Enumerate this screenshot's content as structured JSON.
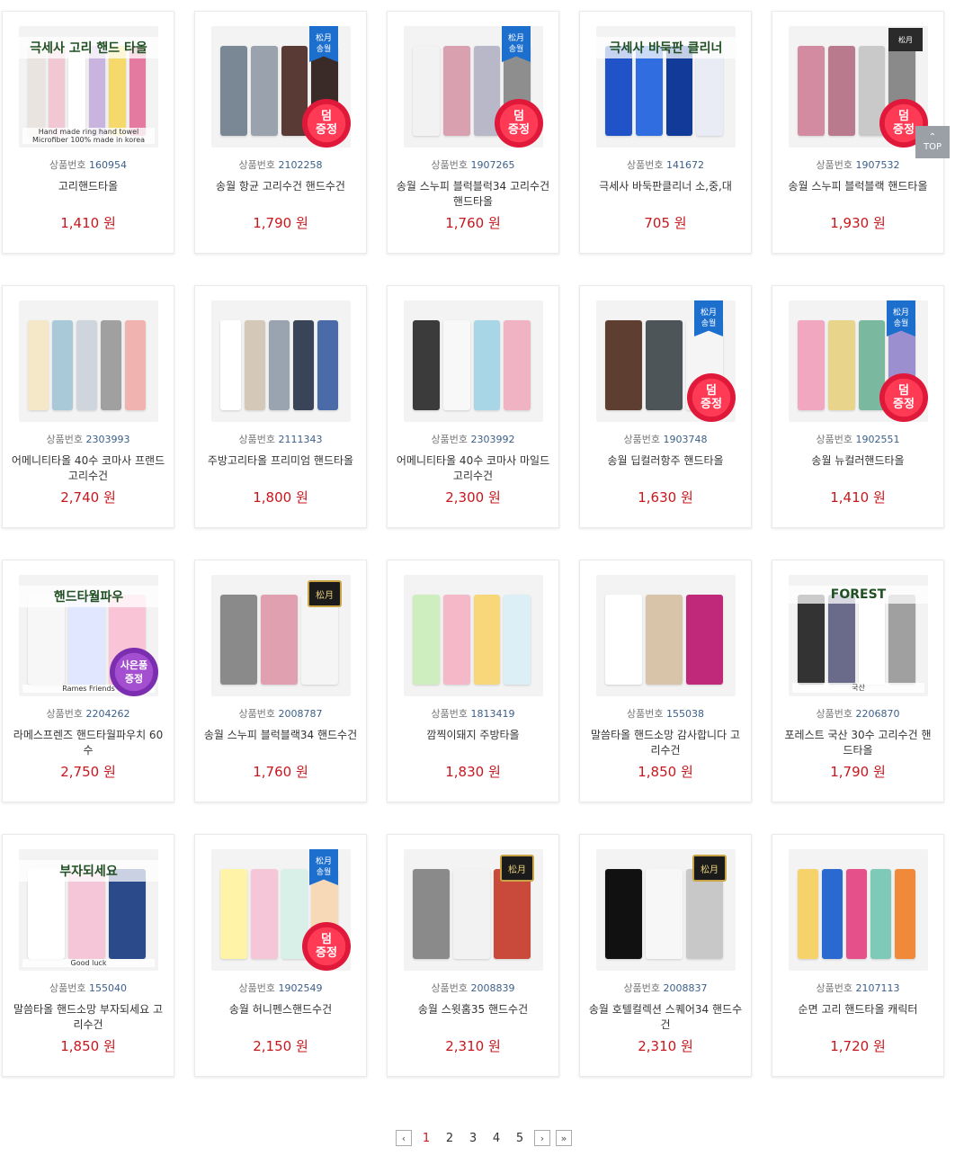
{
  "code_label": "상품번호",
  "currency": "원",
  "top_label": "TOP",
  "products": [
    {
      "code": "160954",
      "name": "고리핸드타올",
      "price": "1,410",
      "badge": "",
      "gift": "",
      "img_text": "극세사 고리 핸드 타올",
      "img_sub": "Hand made ring hand towel Microfiber 100% made in korea"
    },
    {
      "code": "2102258",
      "name": "송월 항균 고리수건 핸드수건",
      "price": "1,790",
      "badge": "blue",
      "gift": "덤 증정",
      "img_text": "",
      "img_sub": ""
    },
    {
      "code": "1907265",
      "name": "송월 스누피 블럭블럭34 고리수건 핸드타올",
      "price": "1,760",
      "badge": "blue",
      "gift": "덤 증정",
      "img_text": "",
      "img_sub": ""
    },
    {
      "code": "141672",
      "name": "극세사 바둑판클리너 소,중,대",
      "price": "705",
      "badge": "",
      "gift": "",
      "img_text": "극세사 바둑판 클리너",
      "img_sub": ""
    },
    {
      "code": "1907532",
      "name": "송월 스누피 블럭블랙 핸드타올",
      "price": "1,930",
      "badge": "dark",
      "gift": "덤 증정",
      "img_text": "",
      "img_sub": ""
    },
    {
      "code": "2303993",
      "name": "어메니티타올 40수 코마사 프랜드 고리수건",
      "price": "2,740",
      "badge": "",
      "gift": "",
      "img_text": "",
      "img_sub": ""
    },
    {
      "code": "2111343",
      "name": "주방고리타올 프리미엄 핸드타올",
      "price": "1,800",
      "badge": "",
      "gift": "",
      "img_text": "",
      "img_sub": ""
    },
    {
      "code": "2303992",
      "name": "어메니티타올 40수 코마사 마일드 고리수건",
      "price": "2,300",
      "badge": "",
      "gift": "",
      "img_text": "",
      "img_sub": ""
    },
    {
      "code": "1903748",
      "name": "송월 딥컬러항주 핸드타올",
      "price": "1,630",
      "badge": "blue",
      "gift": "덤 증정",
      "img_text": "",
      "img_sub": ""
    },
    {
      "code": "1902551",
      "name": "송월 뉴컬러핸드타올",
      "price": "1,410",
      "badge": "blue",
      "gift": "덤 증정",
      "img_text": "",
      "img_sub": ""
    },
    {
      "code": "2204262",
      "name": "라메스프렌즈 핸드타월파우치 60수",
      "price": "2,750",
      "badge": "",
      "gift": "사은품 증정",
      "img_text": "핸드타월파우",
      "img_sub": "Rames Friends"
    },
    {
      "code": "2008787",
      "name": "송월 스누피 블럭블랙34 핸드수건",
      "price": "1,760",
      "badge": "gold",
      "gift": "",
      "img_text": "",
      "img_sub": ""
    },
    {
      "code": "1813419",
      "name": "깜찍이돼지 주방타올",
      "price": "1,830",
      "badge": "",
      "gift": "",
      "img_text": "",
      "img_sub": ""
    },
    {
      "code": "155038",
      "name": "말씀타올 핸드소망 감사합니다 고리수건",
      "price": "1,850",
      "badge": "",
      "gift": "",
      "img_text": "",
      "img_sub": ""
    },
    {
      "code": "2206870",
      "name": "포레스트 국산 30수 고리수건 핸드타올",
      "price": "1,790",
      "badge": "",
      "gift": "",
      "img_text": "FOREST",
      "img_sub": "국산"
    },
    {
      "code": "155040",
      "name": "말씀타올 핸드소망 부자되세요 고리수건",
      "price": "1,850",
      "badge": "",
      "gift": "",
      "img_text": "부자되세요",
      "img_sub": "Good luck"
    },
    {
      "code": "1902549",
      "name": "송월 허니펜스핸드수건",
      "price": "2,150",
      "badge": "blue",
      "gift": "덤 증정",
      "img_text": "",
      "img_sub": ""
    },
    {
      "code": "2008839",
      "name": "송월 스윗홈35 핸드수건",
      "price": "2,310",
      "badge": "gold",
      "gift": "",
      "img_text": "",
      "img_sub": ""
    },
    {
      "code": "2008837",
      "name": "송월 호텔컬렉션 스퀘어34 핸드수건",
      "price": "2,310",
      "badge": "gold",
      "gift": "",
      "img_text": "",
      "img_sub": ""
    },
    {
      "code": "2107113",
      "name": "순면 고리 핸드타올 캐릭터",
      "price": "1,720",
      "badge": "",
      "gift": "",
      "img_text": "",
      "img_sub": ""
    }
  ],
  "pagination": {
    "prev": "‹",
    "pages": [
      "1",
      "2",
      "3",
      "4",
      "5"
    ],
    "current": "1",
    "next": "›",
    "last": "»"
  },
  "colors": {
    "price": "#c8161d",
    "code_number": "#3b5f8a",
    "gift_badge": "#ff3a55",
    "brand_blue": "#1d6fce"
  }
}
